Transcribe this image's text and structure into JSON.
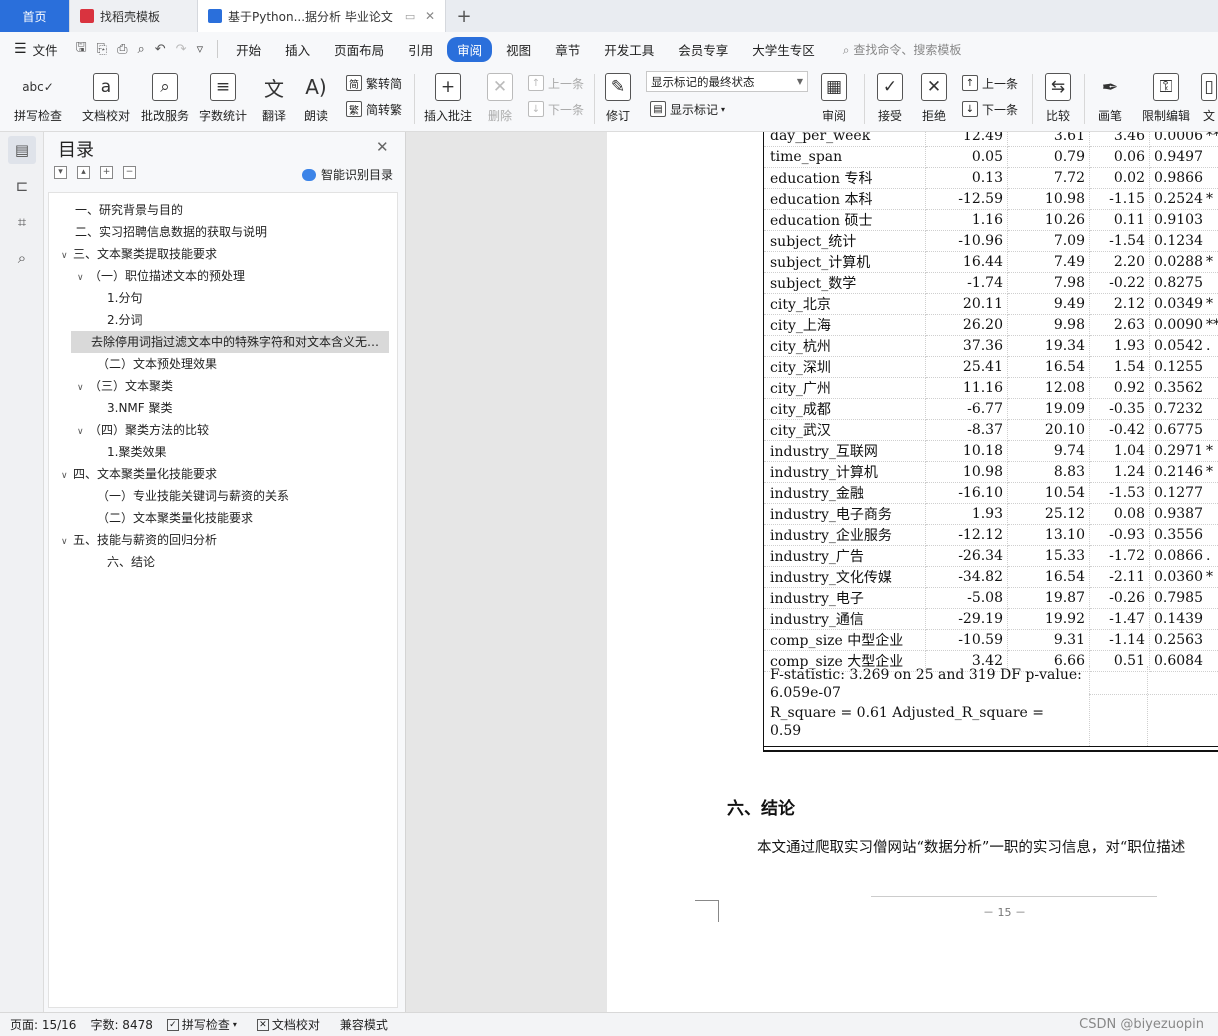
{
  "tabs": [
    {
      "label": "首页"
    },
    {
      "label": "找稻壳模板"
    },
    {
      "label": "基于Python...据分析 毕业论文"
    }
  ],
  "menu": {
    "file": "文件",
    "items": [
      "开始",
      "插入",
      "页面布局",
      "引用",
      "审阅",
      "视图",
      "章节",
      "开发工具",
      "会员专享",
      "大学生专区"
    ],
    "active": "审阅",
    "search": "查找命令、搜索模板"
  },
  "ribbon": {
    "spell": "拼写检查",
    "proof": "文档校对",
    "batch": "批改服务",
    "wordcount": "字数统计",
    "translate": "翻译",
    "read": "朗读",
    "trad": "繁转简",
    "simp": "简转繁",
    "insert_comment": "插入批注",
    "delete": "删除",
    "prev": "上一条",
    "next": "下一条",
    "revise": "修订",
    "markup_state": "显示标记的最终状态",
    "show_markup": "显示标记",
    "review": "审阅",
    "accept": "接受",
    "reject": "拒绝",
    "prev2": "上一条",
    "next2": "下一条",
    "compare": "比较",
    "pen": "画笔",
    "restrict": "限制编辑",
    "doc_cut": "文"
  },
  "toc": {
    "title": "目录",
    "smart": "智能识别目录",
    "items": [
      "一、研究背景与目的",
      "二、实习招聘信息数据的获取与说明",
      "三、文本聚类提取技能要求",
      "（一）职位描述文本的预处理",
      "1.分句",
      "2.分词",
      "去除停用词指过滤文本中的特殊字符和对文本含义无…",
      "（二）文本预处理效果",
      "（三）文本聚类",
      "3.NMF 聚类",
      "（四）聚类方法的比较",
      "1.聚类效果",
      "四、文本聚类量化技能要求",
      "（一）专业技能关键词与薪资的关系",
      "（二）文本聚类量化技能要求",
      "五、技能与薪资的回归分析",
      "六、结论"
    ]
  },
  "regression": {
    "rows": [
      [
        "day_per_week",
        "12.49",
        "3.61",
        "3.46",
        "0.0006",
        "**"
      ],
      [
        "time_span",
        "0.05",
        "0.79",
        "0.06",
        "0.9497",
        ""
      ],
      [
        "education 专科",
        "0.13",
        "7.72",
        "0.02",
        "0.9866",
        ""
      ],
      [
        "education 本科",
        "-12.59",
        "10.98",
        "-1.15",
        "0.2524",
        "*"
      ],
      [
        "education 硕士",
        "1.16",
        "10.26",
        "0.11",
        "0.9103",
        ""
      ],
      [
        "subject_统计",
        "-10.96",
        "7.09",
        "-1.54",
        "0.1234",
        ""
      ],
      [
        "subject_计算机",
        "16.44",
        "7.49",
        "2.20",
        "0.0288",
        "*"
      ],
      [
        "subject_数学",
        "-1.74",
        "7.98",
        "-0.22",
        "0.8275",
        ""
      ],
      [
        "city_北京",
        "20.11",
        "9.49",
        "2.12",
        "0.0349",
        "*"
      ],
      [
        "city_上海",
        "26.20",
        "9.98",
        "2.63",
        "0.0090",
        "**"
      ],
      [
        "city_杭州",
        "37.36",
        "19.34",
        "1.93",
        "0.0542",
        "."
      ],
      [
        "city_深圳",
        "25.41",
        "16.54",
        "1.54",
        "0.1255",
        ""
      ],
      [
        "city_广州",
        "11.16",
        "12.08",
        "0.92",
        "0.3562",
        ""
      ],
      [
        "city_成都",
        "-6.77",
        "19.09",
        "-0.35",
        "0.7232",
        ""
      ],
      [
        "city_武汉",
        "-8.37",
        "20.10",
        "-0.42",
        "0.6775",
        ""
      ],
      [
        "industry_互联网",
        "10.18",
        "9.74",
        "1.04",
        "0.2971",
        "*"
      ],
      [
        "industry_计算机",
        "10.98",
        "8.83",
        "1.24",
        "0.2146",
        "*"
      ],
      [
        "industry_金融",
        "-16.10",
        "10.54",
        "-1.53",
        "0.1277",
        ""
      ],
      [
        "industry_电子商务",
        "1.93",
        "25.12",
        "0.08",
        "0.9387",
        ""
      ],
      [
        "industry_企业服务",
        "-12.12",
        "13.10",
        "-0.93",
        "0.3556",
        ""
      ],
      [
        "industry_广告",
        "-26.34",
        "15.33",
        "-1.72",
        "0.0866",
        "."
      ],
      [
        "industry_文化传媒",
        "-34.82",
        "16.54",
        "-2.11",
        "0.0360",
        "*"
      ],
      [
        "industry_电子",
        "-5.08",
        "19.87",
        "-0.26",
        "0.7985",
        ""
      ],
      [
        "industry_通信",
        "-29.19",
        "19.92",
        "-1.47",
        "0.1439",
        ""
      ],
      [
        "comp_size 中型企业",
        "-10.59",
        "9.31",
        "-1.14",
        "0.2563",
        ""
      ],
      [
        "comp_size 大型企业",
        "3.42",
        "6.66",
        "0.51",
        "0.6084",
        ""
      ]
    ],
    "f_stat_1": "F-statistic: 3.269 on 25 and 319 DF p-value:",
    "f_stat_2": "6.059e-07",
    "r2_1": "R_square = 0.61 Adjusted_R_square =",
    "r2_2": "0.59"
  },
  "doc": {
    "heading": "六、结论",
    "paragraph": "本文通过爬取实习僧网站“数据分析”一职的实习信息，对“职位描述",
    "page_number": "－ 15 －"
  },
  "status": {
    "page": "页面: 15/16",
    "words": "字数: 8478",
    "spell": "拼写检查",
    "proof": "文档校对",
    "compat": "兼容模式",
    "watermark": "CSDN @biyezuopin"
  }
}
